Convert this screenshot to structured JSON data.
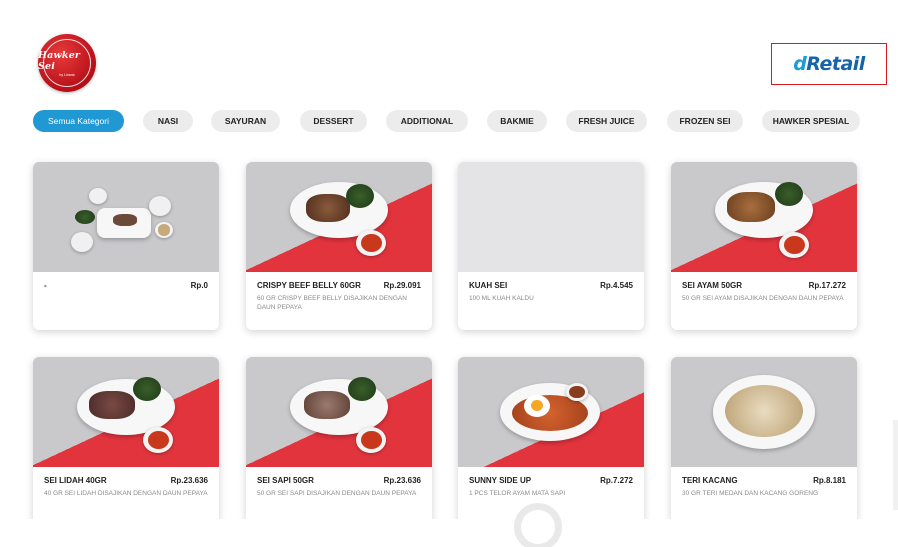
{
  "header": {
    "logo_text": "Hawker Sei",
    "logo_sub": "by Linaria",
    "brand_prefix": "d",
    "brand_suffix": "Retail"
  },
  "categories": [
    {
      "label": "Semua Kategori",
      "active": true
    },
    {
      "label": "NASI",
      "active": false
    },
    {
      "label": "SAYURAN",
      "active": false
    },
    {
      "label": "DESSERT",
      "active": false
    },
    {
      "label": "ADDITIONAL",
      "active": false
    },
    {
      "label": "BAKMIE",
      "active": false
    },
    {
      "label": "FRESH JUICE",
      "active": false
    },
    {
      "label": "FROZEN SEI",
      "active": false
    },
    {
      "label": "HAWKER SPESIAL",
      "active": false
    }
  ],
  "products": [
    {
      "name": "-",
      "price": "Rp.0",
      "desc": ""
    },
    {
      "name": "CRISPY BEEF BELLY 60GR",
      "price": "Rp.29.091",
      "desc": "60 GR CRISPY BEEF BELLY DISAJIKAN DENGAN DAUN PEPAYA"
    },
    {
      "name": "KUAH SEI",
      "price": "Rp.4.545",
      "desc": "100 ML KUAH KALDU"
    },
    {
      "name": "SEI AYAM 50GR",
      "price": "Rp.17.272",
      "desc": "50 GR SEI AYAM DISAJIKAN DENGAN DAUN PEPAYA"
    },
    {
      "name": "SEI LIDAH 40GR",
      "price": "Rp.23.636",
      "desc": "40 GR SEI LIDAH DISAJIKAN DENGAN DAUN PEPAYA"
    },
    {
      "name": "SEI SAPI 50GR",
      "price": "Rp.23.636",
      "desc": "50 GR SEI SAPI DISAJIKAN DENGAN DAUN PEPAYA"
    },
    {
      "name": "SUNNY SIDE UP",
      "price": "Rp.7.272",
      "desc": "1 PCS TELOR AYAM MATA SAPI"
    },
    {
      "name": "TERI KACANG",
      "price": "Rp.8.181",
      "desc": "30 GR TERI MEDAN DAN KACANG GORENG"
    }
  ],
  "colors": {
    "accent": "#1f98d3",
    "brand_red": "#d71920",
    "photo_red": "#e2343d",
    "brand_blue": "#1565a8"
  }
}
